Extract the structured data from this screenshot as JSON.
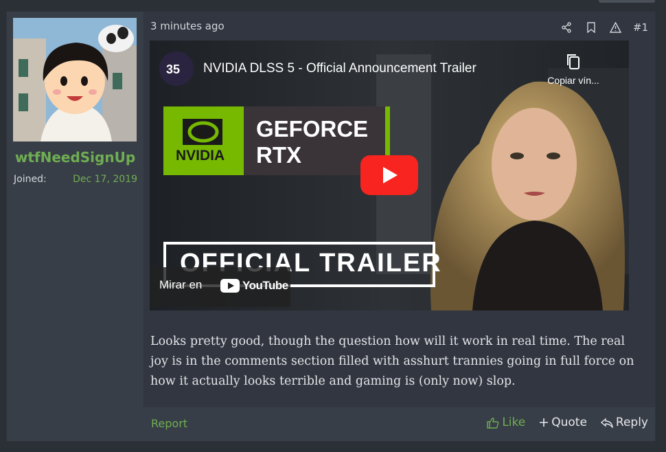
{
  "post": {
    "user": {
      "name": "wtfNeedSignUp",
      "joined_label": "Joined:",
      "joined_date": "Dec 17, 2019"
    },
    "timestamp": "3 minutes ago",
    "post_number": "#1",
    "video": {
      "title": "NVIDIA DLSS 5 - Official Announcement Trailer",
      "copy_label": "Copiar vín...",
      "watch_on": "Mirar en",
      "youtube": "YouTube",
      "thumb_brand": "NVIDIA",
      "thumb_line1": "GEFORCE",
      "thumb_line2": "RTX",
      "thumb_banner": "OFFICIAL TRAILER"
    },
    "body": "Looks pretty good, though the question how will it work in real time. The real joy is in the comments section filled with asshurt trannies going in full force on how it actually looks terrible and gaming is (only now) slop.",
    "footer": {
      "report": "Report",
      "like": "Like",
      "quote": "Quote",
      "reply": "Reply"
    }
  },
  "colors": {
    "accent": "#6fae52",
    "nvidia_green": "#76b900",
    "youtube_red": "#f7241f"
  }
}
